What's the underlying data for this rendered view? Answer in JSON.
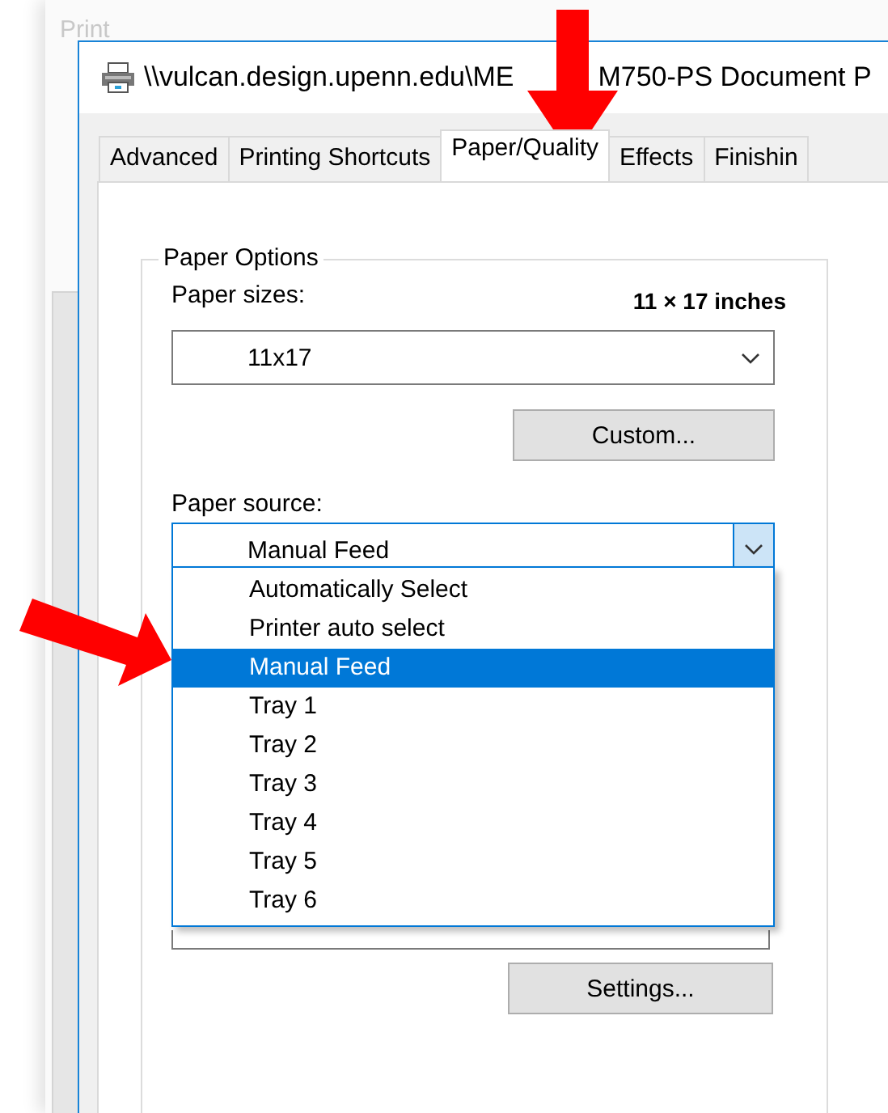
{
  "background_window": {
    "title": "Print"
  },
  "window": {
    "title_segments": [
      "\\\\vulcan.design.upenn.edu\\ME",
      "M750-PS Document P"
    ]
  },
  "tabs": [
    {
      "label": "Advanced",
      "selected": false
    },
    {
      "label": "Printing Shortcuts",
      "selected": false
    },
    {
      "label": "Paper/Quality",
      "selected": true
    },
    {
      "label": "Effects",
      "selected": false
    },
    {
      "label": "Finishin",
      "selected": false
    }
  ],
  "paper_options": {
    "title": "Paper Options",
    "paper_sizes": {
      "label": "Paper sizes:",
      "dimensions": "11 × 17 inches",
      "value": "11x17"
    },
    "custom_button": "Custom...",
    "paper_source": {
      "label": "Paper source:",
      "value": "Manual Feed",
      "expanded": true,
      "options": [
        {
          "label": "Automatically Select",
          "selected": false
        },
        {
          "label": "Printer auto select",
          "selected": false
        },
        {
          "label": "Manual Feed",
          "selected": true
        },
        {
          "label": "Tray 1",
          "selected": false
        },
        {
          "label": "Tray 2",
          "selected": false
        },
        {
          "label": "Tray 3",
          "selected": false
        },
        {
          "label": "Tray 4",
          "selected": false
        },
        {
          "label": "Tray 5",
          "selected": false
        },
        {
          "label": "Tray 6",
          "selected": false
        }
      ]
    },
    "settings_button": "Settings..."
  },
  "annotations": [
    {
      "kind": "down"
    },
    {
      "kind": "diagonal"
    }
  ]
}
